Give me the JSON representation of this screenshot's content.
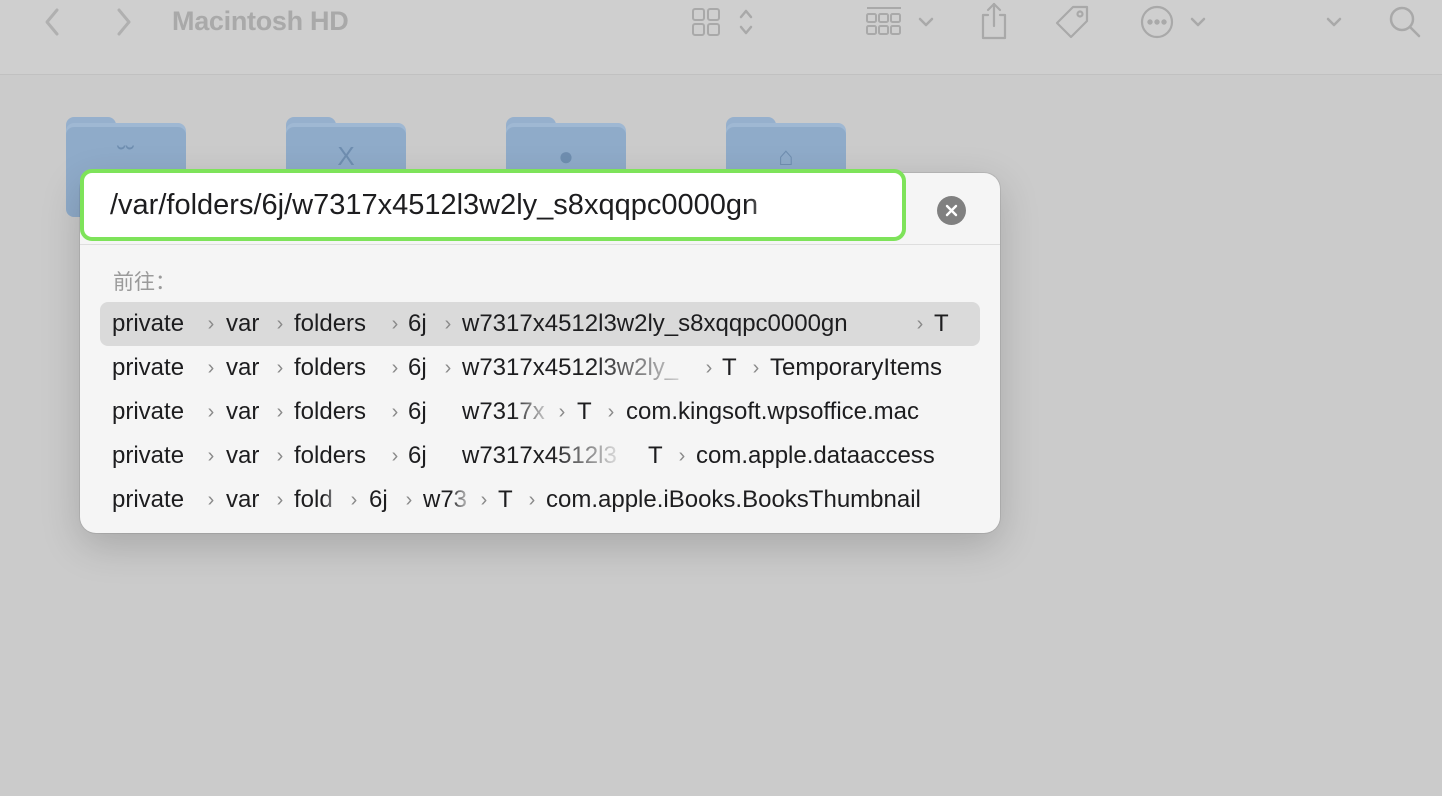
{
  "toolbar": {
    "title": "Macintosh HD",
    "icons": [
      "back-icon",
      "forward-icon",
      "view-grid-icon",
      "sort-arrows-icon",
      "group-icon",
      "chevron-down-icon",
      "share-icon",
      "tag-icon",
      "more-icon",
      "chevron-down-icon",
      "search-icon"
    ]
  },
  "folders": [
    {
      "glyph": "˘˘"
    },
    {
      "glyph": "X"
    },
    {
      "glyph": "●"
    },
    {
      "glyph": "⌂"
    }
  ],
  "goto": {
    "path_value": "/var/folders/6j/w7317x4512l3w2ly_s8xqqpc0000gn",
    "go_label": "前往：",
    "clear_icon": "clear-icon",
    "colors": {
      "focus_ring": "#7ee35a",
      "selected_row": "#dadada"
    },
    "suggestions": [
      [
        "private",
        "var",
        "folders",
        "6j",
        "w7317x4512l3w2ly_s8xqqpc0000gn",
        "T"
      ],
      [
        "private",
        "var",
        "folders",
        "6j",
        "w7317x4512l3w2ly_",
        "T",
        "TemporaryItems"
      ],
      [
        "private",
        "var",
        "folders",
        "6j",
        "w7317x",
        "T",
        "com.kingsoft.wpsoffice.mac"
      ],
      [
        "private",
        "var",
        "folders",
        "6j",
        "w7317x4512l3",
        "T",
        "com.apple.dataaccess"
      ],
      [
        "private",
        "var",
        "fold",
        "6j",
        "w73",
        "T",
        "com.apple.iBooks.BooksThumbnail"
      ]
    ],
    "selected_index": 0
  }
}
